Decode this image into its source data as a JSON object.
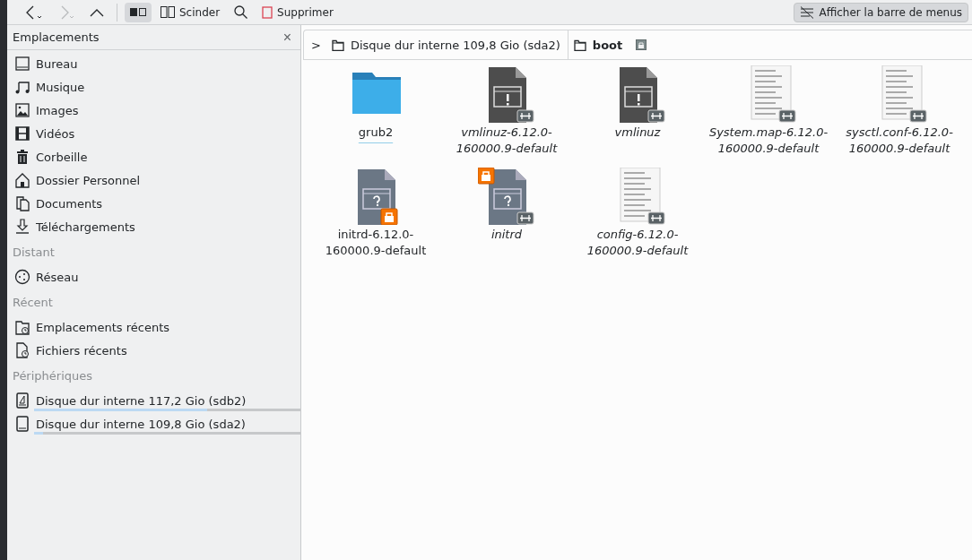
{
  "toolbar": {
    "back": {
      "disabled": false
    },
    "forward": {
      "disabled": true
    },
    "view_mode": {
      "selected": true
    },
    "split": {
      "label": "Scinder"
    },
    "delete": {
      "label": "Supprimer"
    },
    "menubar": {
      "label": "Afficher la barre de menus"
    }
  },
  "sidebar": {
    "title": "Emplacements",
    "close": "×",
    "sections": [
      {
        "items": [
          {
            "label": "Bureau"
          },
          {
            "label": "Musique"
          },
          {
            "label": "Images"
          },
          {
            "label": "Vidéos"
          },
          {
            "label": "Corbeille"
          },
          {
            "label": "Dossier Personnel"
          },
          {
            "label": "Documents"
          },
          {
            "label": "Téléchargements"
          }
        ]
      },
      {
        "heading": "Distant",
        "items": [
          {
            "label": "Réseau"
          }
        ]
      },
      {
        "heading": "Récent",
        "items": [
          {
            "label": "Emplacements récents"
          },
          {
            "label": "Fichiers récents"
          }
        ]
      },
      {
        "heading": "Périphériques",
        "items": [
          {
            "label": "Disque dur interne 117,2 Gio (sdb2)",
            "level": 0.65
          },
          {
            "label": "Disque dur interne 109,8 Gio (sda2)",
            "level": 0.035
          }
        ]
      }
    ]
  },
  "breadcrumb": {
    "expander": ">",
    "parts": [
      {
        "label": "Disque dur interne 109,8 Gio (sda2)",
        "current": false
      },
      {
        "label": "boot",
        "current": true,
        "locked": true
      }
    ]
  },
  "files": [
    {
      "name": "grub2",
      "kind": "folder",
      "symlink": false,
      "locked": false,
      "focused": true
    },
    {
      "name": "vmlinuz-6.12.0-160000.9-default",
      "kind": "executable",
      "symlink": true,
      "locked": false,
      "focused": false
    },
    {
      "name": "vmlinuz",
      "kind": "executable",
      "symlink": true,
      "locked": false,
      "focused": false
    },
    {
      "name": "System.map-6.12.0-160000.9-default",
      "kind": "text",
      "symlink": true,
      "locked": false,
      "focused": false
    },
    {
      "name": "sysctl.conf-6.12.0-160000.9-default",
      "kind": "text",
      "symlink": true,
      "locked": false,
      "focused": false
    },
    {
      "name": "initrd-6.12.0-160000.9-default",
      "kind": "unknown",
      "symlink": false,
      "locked": true,
      "focused": false
    },
    {
      "name": "initrd",
      "kind": "unknown",
      "symlink": true,
      "locked": true,
      "focused": false
    },
    {
      "name": "config-6.12.0-160000.9-default",
      "kind": "text",
      "symlink": true,
      "locked": false,
      "focused": false
    }
  ]
}
